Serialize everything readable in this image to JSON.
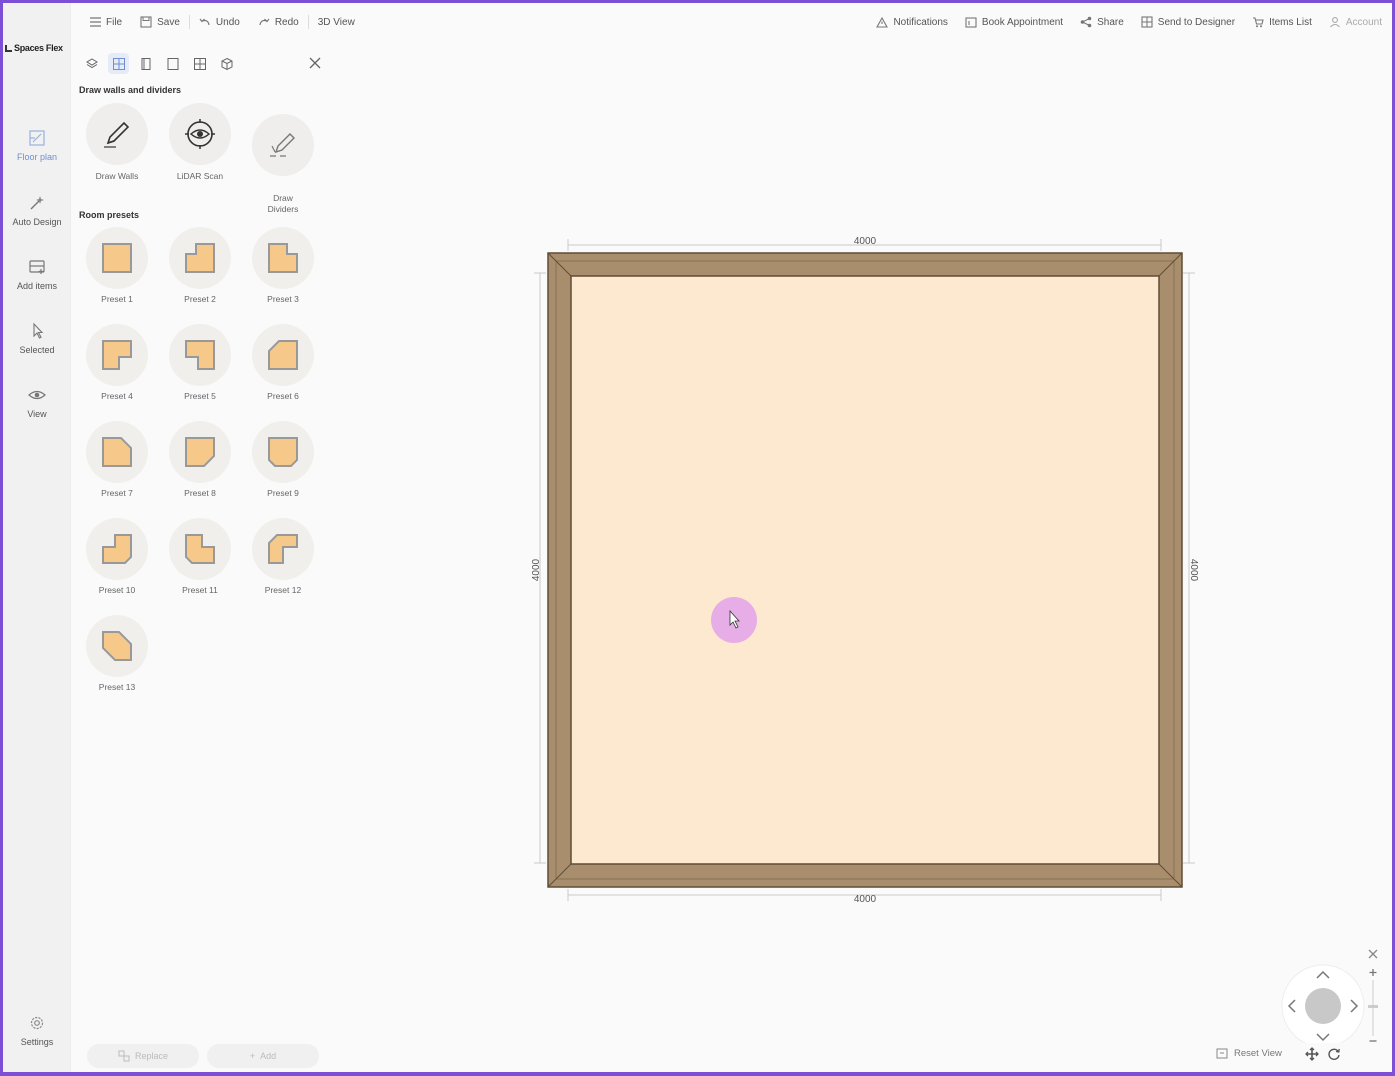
{
  "app": {
    "brand": "Spaces Flex"
  },
  "topbar": {
    "left": [
      {
        "label": "File",
        "icon": "menu-icon"
      },
      {
        "label": "Save",
        "icon": "save-icon"
      },
      {
        "label": "Undo",
        "icon": "undo-icon"
      },
      {
        "label": "Redo",
        "icon": "redo-icon"
      },
      {
        "label": "3D View",
        "icon": ""
      }
    ],
    "right": [
      {
        "label": "Notifications",
        "icon": "warning-icon"
      },
      {
        "label": "Book Appointment",
        "icon": "calendar-icon"
      },
      {
        "label": "Share",
        "icon": "share-icon"
      },
      {
        "label": "Send to Designer",
        "icon": "send-icon"
      },
      {
        "label": "Items List",
        "icon": "cart-icon"
      },
      {
        "label": "Account",
        "icon": "user-icon"
      }
    ]
  },
  "rail": {
    "items": [
      {
        "label": "Floor plan",
        "icon": "floorplan-icon",
        "active": true
      },
      {
        "label": "Auto Design",
        "icon": "magic-wand-icon"
      },
      {
        "label": "Add items",
        "icon": "add-items-icon"
      },
      {
        "label": "Selected",
        "icon": "cursor-icon"
      },
      {
        "label": "View",
        "icon": "eye-icon"
      }
    ],
    "settings": "Settings"
  },
  "panel": {
    "draw_title": "Draw walls and dividers",
    "tools": [
      {
        "label": "Draw Walls",
        "icon": "pencil-icon"
      },
      {
        "label": "LiDAR Scan",
        "icon": "target-icon"
      },
      {
        "label": "Draw\nDividers",
        "icon": "pencil-dividers-icon"
      }
    ],
    "presets_title": "Room presets",
    "presets": [
      "Preset 1",
      "Preset 2",
      "Preset 3",
      "Preset 4",
      "Preset 5",
      "Preset 6",
      "Preset 7",
      "Preset 8",
      "Preset 9",
      "Preset 10",
      "Preset 11",
      "Preset 12",
      "Preset 13"
    ],
    "replace_label": "Replace",
    "add_label": "Add"
  },
  "plan": {
    "dim_top": "4000",
    "dim_bottom": "4000",
    "dim_left": "4000",
    "dim_right": "4000",
    "wall_color": "#a88e6c",
    "floor_color": "#fde9d0",
    "cursor_highlight": "#e3a6e8"
  },
  "view_controls": {
    "reset_view": "Reset View"
  },
  "colors": {
    "accent": "#6f8fd0",
    "frame": "#7b4fd6",
    "preset_fill": "#f6c98a"
  }
}
